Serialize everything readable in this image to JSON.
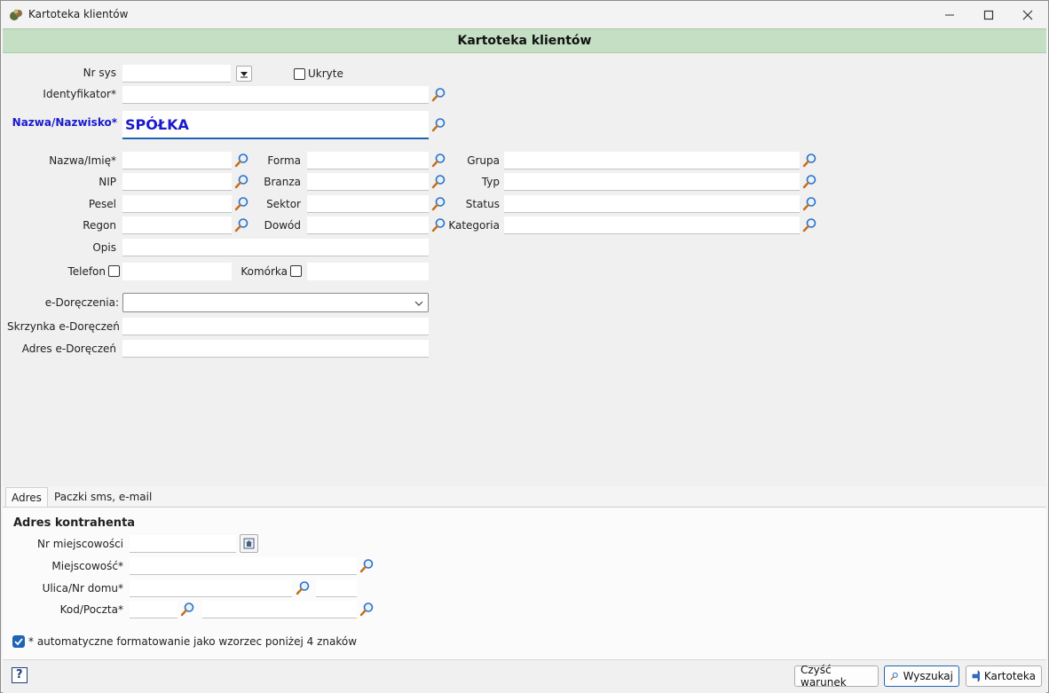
{
  "window": {
    "title": "Kartoteka klientów",
    "minimize_label": "—",
    "maximize_label": "☐",
    "close_label": "✕"
  },
  "header": {
    "title": "Kartoteka klientów"
  },
  "form": {
    "nr_sys": {
      "label": "Nr sys",
      "value": ""
    },
    "ukryte": {
      "label": "Ukryte",
      "checked": false
    },
    "identyfikator": {
      "label": "Identyfikator*",
      "value": ""
    },
    "nazwa_nazwisko": {
      "label": "Nazwa/Nazwisko*",
      "value": "SPÓŁKA"
    },
    "nazwa_imie": {
      "label": "Nazwa/Imię*",
      "value": ""
    },
    "nip": {
      "label": "NIP",
      "value": ""
    },
    "pesel": {
      "label": "Pesel",
      "value": ""
    },
    "regon": {
      "label": "Regon",
      "value": ""
    },
    "forma": {
      "label": "Forma",
      "value": ""
    },
    "branza": {
      "label": "Branza",
      "value": ""
    },
    "sektor": {
      "label": "Sektor",
      "value": ""
    },
    "dowod": {
      "label": "Dowód",
      "value": ""
    },
    "grupa": {
      "label": "Grupa",
      "value": ""
    },
    "typ": {
      "label": "Typ",
      "value": ""
    },
    "status": {
      "label": "Status",
      "value": ""
    },
    "kategoria": {
      "label": "Kategoria",
      "value": ""
    },
    "opis": {
      "label": "Opis",
      "value": ""
    },
    "telefon": {
      "label": "Telefon",
      "checked": false,
      "value": ""
    },
    "komorka": {
      "label": "Komórka",
      "checked": false,
      "value": ""
    },
    "e_doreczenia": {
      "label": "e-Doręczenia:",
      "value": ""
    },
    "skrzynka": {
      "label": "Skrzynka e-Doręczeń",
      "value": ""
    },
    "adres_ed": {
      "label": "Adres e-Doręczeń",
      "value": ""
    }
  },
  "tabs": [
    {
      "label": "Adres",
      "active": true
    },
    {
      "label": "Paczki sms, e-mail",
      "active": false
    }
  ],
  "address": {
    "section_title": "Adres kontrahenta",
    "nr_miejscowosci": {
      "label": "Nr miejscowości",
      "value": ""
    },
    "miejscowosc": {
      "label": "Miejscowość*",
      "value": ""
    },
    "ulica": {
      "label": "Ulica/Nr domu*",
      "value": "",
      "nr_value": ""
    },
    "kod_poczta": {
      "label": "Kod/Poczta*",
      "kod_value": "",
      "poczta_value": ""
    },
    "auto_format": {
      "label": "* automatyczne formatowanie jako wzorzec poniżej 4 znaków",
      "checked": true
    }
  },
  "footer": {
    "help_label": "?",
    "clear_label": "Czyść warunek",
    "search_label": "Wyszukaj",
    "kartoteka_label": "Kartoteka"
  },
  "colors": {
    "header_band": "#c4dfc4",
    "accent": "#1f63b5",
    "highlight_label": "#1a1acc",
    "checkbox_checked": "#1f63b5"
  }
}
